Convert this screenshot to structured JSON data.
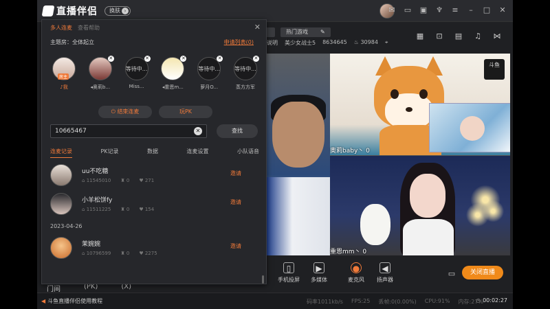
{
  "app": {
    "title": "直播伴侣",
    "theme_label": "换肤",
    "window_icons": [
      "mail-icon",
      "message-icon",
      "save-icon",
      "shirt-icon",
      "menu-icon",
      "minimize-icon",
      "maximize-icon",
      "close-icon"
    ]
  },
  "stream": {
    "tags": [
      "",
      "热门游戏"
    ],
    "meta": [
      "说明",
      "美少女战士5",
      "8634645",
      "30984"
    ],
    "labels": {
      "cam_top": "奥莉baby丶 0",
      "cam_bottom": "重恩mm丶 0",
      "brand_badge": "斗鱼"
    }
  },
  "toolbar": {
    "items": [
      {
        "label": "手机投屏",
        "icon": "phone-icon"
      },
      {
        "label": "多媒体",
        "icon": "play-icon"
      },
      {
        "label": "麦克风",
        "icon": "mic-icon"
      },
      {
        "label": "扬声器",
        "icon": "speaker-icon"
      }
    ],
    "close_live": "关闭直播"
  },
  "statusbar": {
    "tutorial": "斗鱼直播伴侣使用教程",
    "bitrate": "码率1011kb/s",
    "fps": "FPS:25",
    "drop": "丢帧:0(0.00%)",
    "cpu": "CPU:91%",
    "mem": "内存:27%",
    "time": "00:02:27"
  },
  "left_tabs": [
    "门间",
    "(PK)",
    "(X)"
  ],
  "panel": {
    "tab_active": "多人连麦",
    "tab_inactive": "查看帮助",
    "host_line": "主题房：全体起立",
    "apply_link": "申请列表(0)",
    "seats": [
      {
        "name": "我",
        "status": "host",
        "host_tag": "房主",
        "style": "user"
      },
      {
        "name": "奥莉b...",
        "status": "user",
        "style": "user2"
      },
      {
        "name": "Miss...",
        "status": "wait",
        "wait_text": "等待中..."
      },
      {
        "name": "重恩m...",
        "status": "user",
        "style": "anime"
      },
      {
        "name": "萝月O...",
        "status": "wait",
        "wait_text": "等待中..."
      },
      {
        "name": "蒸方方军",
        "status": "wait",
        "wait_text": "等待中..."
      }
    ],
    "end_button": "结束连麦",
    "pk_button": "玩PK",
    "search_value": "10665467",
    "search_button": "查找",
    "list_tabs": [
      "连麦记录",
      "PK记录",
      "数据",
      "连麦设置",
      "小队语音"
    ],
    "records": [
      {
        "name": "uu不吃糖",
        "id": "11545010",
        "likes": "0",
        "hearts": "271",
        "action": "邀请"
      },
      {
        "name": "小羊松饼fy",
        "id": "11511225",
        "likes": "0",
        "hearts": "154",
        "action": "邀请"
      },
      {
        "name": "茉婉婉",
        "id": "10796599",
        "likes": "0",
        "hearts": "2275",
        "action": "邀请"
      }
    ],
    "date_sep": "2023-04-26"
  }
}
